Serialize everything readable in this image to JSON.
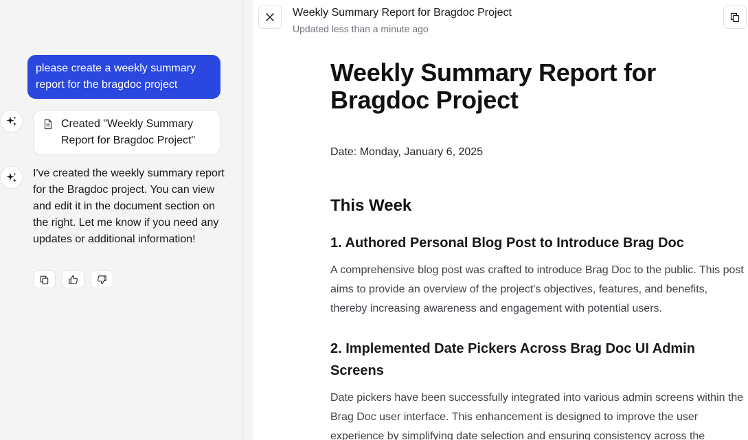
{
  "chat": {
    "user_message": "please create a weekly summary report for the bragdoc project",
    "tool_result": "Created \"Weekly Summary Report for Bragdoc Project\"",
    "assistant_message": "I've created the weekly summary report for the Bragdoc project. You can view and edit it in the document section on the right. Let me know if you need any updates or additional information!",
    "actions": [
      "copy-icon",
      "thumbs-up-icon",
      "thumbs-down-icon"
    ],
    "accent_color": "#2a47e0"
  },
  "artifact": {
    "title": "Weekly Summary Report for Bragdoc Project",
    "updated": "Updated less than a minute ago",
    "document": {
      "heading": "Weekly Summary Report for Bragdoc Project",
      "date": "Date: Monday, January 6, 2025",
      "section_title": "This Week",
      "items": [
        {
          "title": "1. Authored Personal Blog Post to Introduce Brag Doc",
          "body": "A comprehensive blog post was crafted to introduce Brag Doc to the public. This post aims to provide an overview of the project's objectives, features, and benefits, thereby increasing awareness and engagement with potential users."
        },
        {
          "title": "2. Implemented Date Pickers Across Brag Doc UI Admin Screens",
          "body": "Date pickers have been successfully integrated into various admin screens within the Brag Doc user interface. This enhancement is designed to improve the user experience by simplifying date selection and ensuring consistency across the"
        }
      ]
    }
  }
}
